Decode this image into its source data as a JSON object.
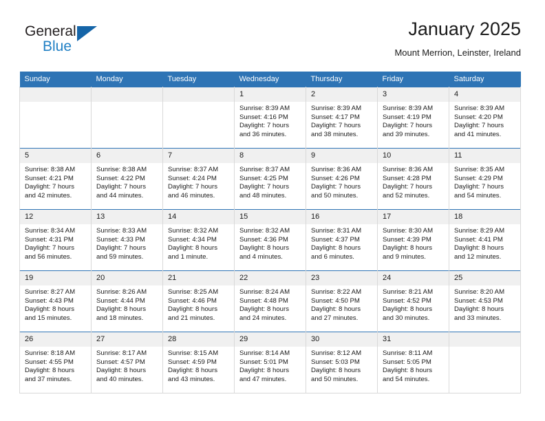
{
  "brand": {
    "name_top": "General",
    "name_bottom": "Blue",
    "triangle_icon": "brand-triangle-icon",
    "accent_color": "#1f7fc4",
    "triangle_color": "#1565a8"
  },
  "header": {
    "title": "January 2025",
    "subtitle": "Mount Merrion, Leinster, Ireland"
  },
  "theme": {
    "header_blue": "#2e74b5",
    "daynum_strip": "#f0f0f0",
    "grid_line": "#d9d9d9"
  },
  "weekdays": [
    "Sunday",
    "Monday",
    "Tuesday",
    "Wednesday",
    "Thursday",
    "Friday",
    "Saturday"
  ],
  "weeks": [
    [
      {
        "day": "",
        "lines": []
      },
      {
        "day": "",
        "lines": []
      },
      {
        "day": "",
        "lines": []
      },
      {
        "day": "1",
        "lines": [
          "Sunrise: 8:39 AM",
          "Sunset: 4:16 PM",
          "Daylight: 7 hours",
          "and 36 minutes."
        ]
      },
      {
        "day": "2",
        "lines": [
          "Sunrise: 8:39 AM",
          "Sunset: 4:17 PM",
          "Daylight: 7 hours",
          "and 38 minutes."
        ]
      },
      {
        "day": "3",
        "lines": [
          "Sunrise: 8:39 AM",
          "Sunset: 4:19 PM",
          "Daylight: 7 hours",
          "and 39 minutes."
        ]
      },
      {
        "day": "4",
        "lines": [
          "Sunrise: 8:39 AM",
          "Sunset: 4:20 PM",
          "Daylight: 7 hours",
          "and 41 minutes."
        ]
      }
    ],
    [
      {
        "day": "5",
        "lines": [
          "Sunrise: 8:38 AM",
          "Sunset: 4:21 PM",
          "Daylight: 7 hours",
          "and 42 minutes."
        ]
      },
      {
        "day": "6",
        "lines": [
          "Sunrise: 8:38 AM",
          "Sunset: 4:22 PM",
          "Daylight: 7 hours",
          "and 44 minutes."
        ]
      },
      {
        "day": "7",
        "lines": [
          "Sunrise: 8:37 AM",
          "Sunset: 4:24 PM",
          "Daylight: 7 hours",
          "and 46 minutes."
        ]
      },
      {
        "day": "8",
        "lines": [
          "Sunrise: 8:37 AM",
          "Sunset: 4:25 PM",
          "Daylight: 7 hours",
          "and 48 minutes."
        ]
      },
      {
        "day": "9",
        "lines": [
          "Sunrise: 8:36 AM",
          "Sunset: 4:26 PM",
          "Daylight: 7 hours",
          "and 50 minutes."
        ]
      },
      {
        "day": "10",
        "lines": [
          "Sunrise: 8:36 AM",
          "Sunset: 4:28 PM",
          "Daylight: 7 hours",
          "and 52 minutes."
        ]
      },
      {
        "day": "11",
        "lines": [
          "Sunrise: 8:35 AM",
          "Sunset: 4:29 PM",
          "Daylight: 7 hours",
          "and 54 minutes."
        ]
      }
    ],
    [
      {
        "day": "12",
        "lines": [
          "Sunrise: 8:34 AM",
          "Sunset: 4:31 PM",
          "Daylight: 7 hours",
          "and 56 minutes."
        ]
      },
      {
        "day": "13",
        "lines": [
          "Sunrise: 8:33 AM",
          "Sunset: 4:33 PM",
          "Daylight: 7 hours",
          "and 59 minutes."
        ]
      },
      {
        "day": "14",
        "lines": [
          "Sunrise: 8:32 AM",
          "Sunset: 4:34 PM",
          "Daylight: 8 hours",
          "and 1 minute."
        ]
      },
      {
        "day": "15",
        "lines": [
          "Sunrise: 8:32 AM",
          "Sunset: 4:36 PM",
          "Daylight: 8 hours",
          "and 4 minutes."
        ]
      },
      {
        "day": "16",
        "lines": [
          "Sunrise: 8:31 AM",
          "Sunset: 4:37 PM",
          "Daylight: 8 hours",
          "and 6 minutes."
        ]
      },
      {
        "day": "17",
        "lines": [
          "Sunrise: 8:30 AM",
          "Sunset: 4:39 PM",
          "Daylight: 8 hours",
          "and 9 minutes."
        ]
      },
      {
        "day": "18",
        "lines": [
          "Sunrise: 8:29 AM",
          "Sunset: 4:41 PM",
          "Daylight: 8 hours",
          "and 12 minutes."
        ]
      }
    ],
    [
      {
        "day": "19",
        "lines": [
          "Sunrise: 8:27 AM",
          "Sunset: 4:43 PM",
          "Daylight: 8 hours",
          "and 15 minutes."
        ]
      },
      {
        "day": "20",
        "lines": [
          "Sunrise: 8:26 AM",
          "Sunset: 4:44 PM",
          "Daylight: 8 hours",
          "and 18 minutes."
        ]
      },
      {
        "day": "21",
        "lines": [
          "Sunrise: 8:25 AM",
          "Sunset: 4:46 PM",
          "Daylight: 8 hours",
          "and 21 minutes."
        ]
      },
      {
        "day": "22",
        "lines": [
          "Sunrise: 8:24 AM",
          "Sunset: 4:48 PM",
          "Daylight: 8 hours",
          "and 24 minutes."
        ]
      },
      {
        "day": "23",
        "lines": [
          "Sunrise: 8:22 AM",
          "Sunset: 4:50 PM",
          "Daylight: 8 hours",
          "and 27 minutes."
        ]
      },
      {
        "day": "24",
        "lines": [
          "Sunrise: 8:21 AM",
          "Sunset: 4:52 PM",
          "Daylight: 8 hours",
          "and 30 minutes."
        ]
      },
      {
        "day": "25",
        "lines": [
          "Sunrise: 8:20 AM",
          "Sunset: 4:53 PM",
          "Daylight: 8 hours",
          "and 33 minutes."
        ]
      }
    ],
    [
      {
        "day": "26",
        "lines": [
          "Sunrise: 8:18 AM",
          "Sunset: 4:55 PM",
          "Daylight: 8 hours",
          "and 37 minutes."
        ]
      },
      {
        "day": "27",
        "lines": [
          "Sunrise: 8:17 AM",
          "Sunset: 4:57 PM",
          "Daylight: 8 hours",
          "and 40 minutes."
        ]
      },
      {
        "day": "28",
        "lines": [
          "Sunrise: 8:15 AM",
          "Sunset: 4:59 PM",
          "Daylight: 8 hours",
          "and 43 minutes."
        ]
      },
      {
        "day": "29",
        "lines": [
          "Sunrise: 8:14 AM",
          "Sunset: 5:01 PM",
          "Daylight: 8 hours",
          "and 47 minutes."
        ]
      },
      {
        "day": "30",
        "lines": [
          "Sunrise: 8:12 AM",
          "Sunset: 5:03 PM",
          "Daylight: 8 hours",
          "and 50 minutes."
        ]
      },
      {
        "day": "31",
        "lines": [
          "Sunrise: 8:11 AM",
          "Sunset: 5:05 PM",
          "Daylight: 8 hours",
          "and 54 minutes."
        ]
      },
      {
        "day": "",
        "lines": []
      }
    ]
  ]
}
